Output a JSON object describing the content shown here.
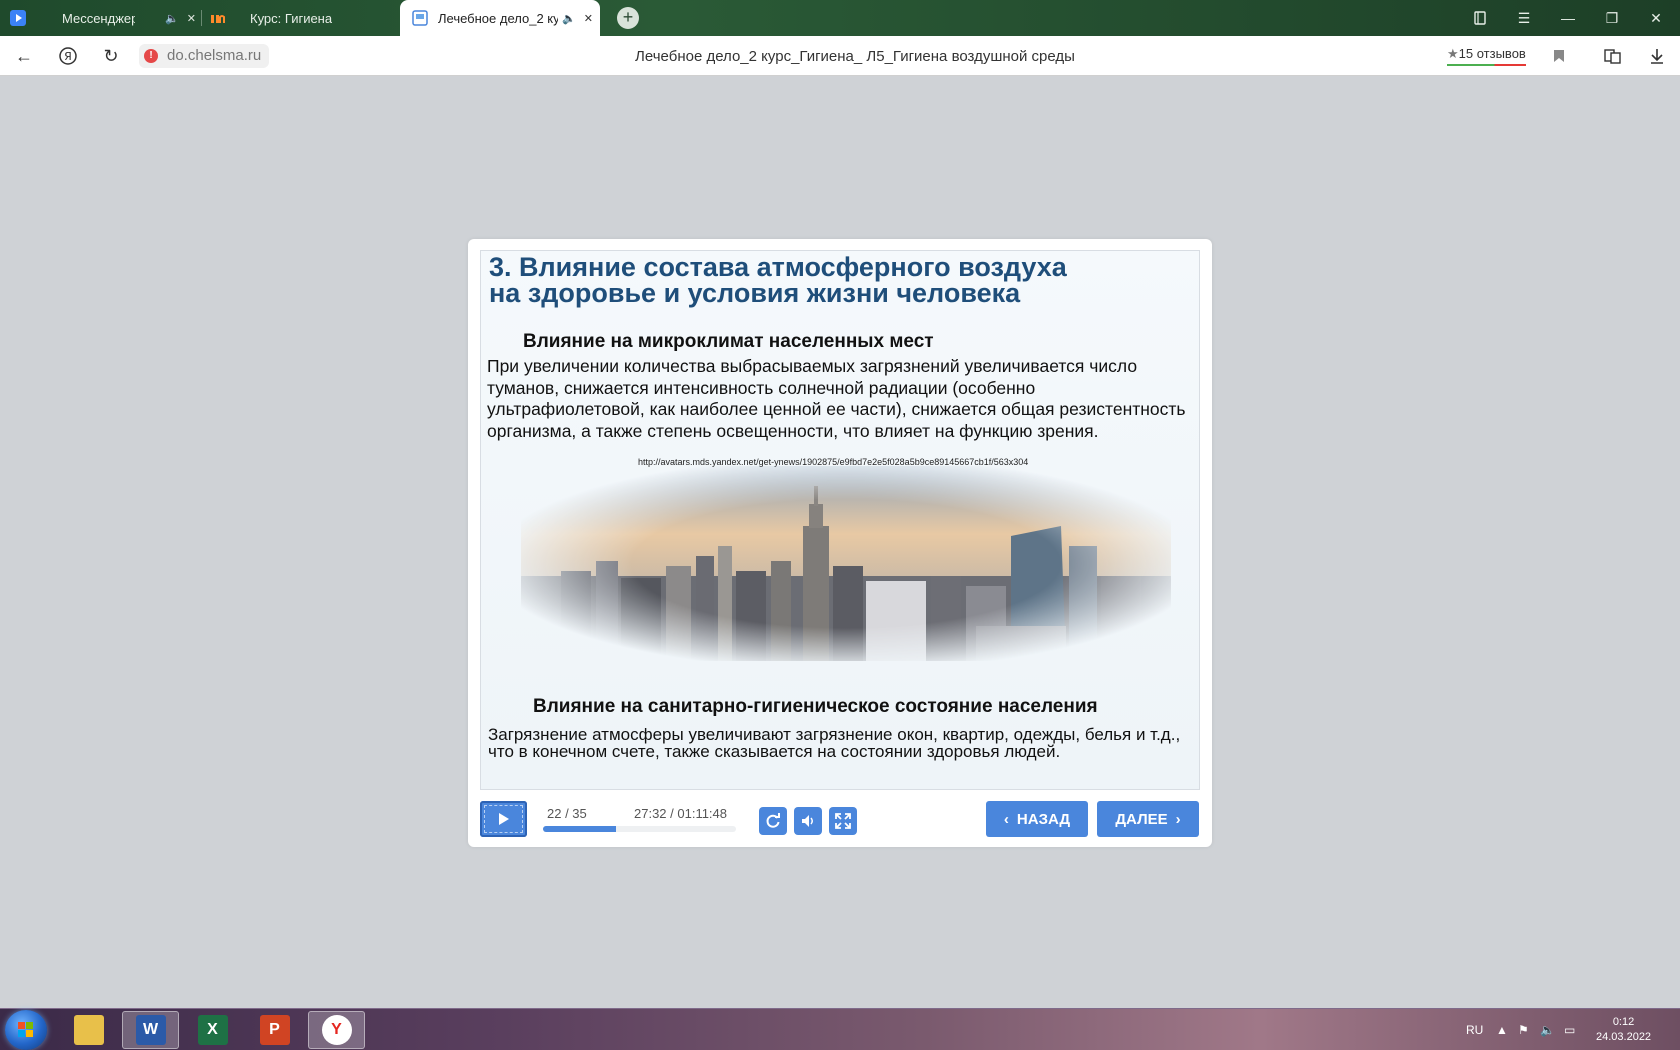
{
  "browser": {
    "tabs": [
      {
        "label": "Мессенджер",
        "icon": "messenger-icon"
      },
      {
        "label": "Курс: Гигиена",
        "icon": "course-icon"
      },
      {
        "label": "Лечебное дело_2 ку",
        "icon": "slide-icon"
      }
    ],
    "new_tab_label": "+",
    "url": "do.chelsma.ru",
    "page_title": "Лечебное дело_2 курс_Гигиена_ Л5_Гигиена воздушной среды",
    "reviews": "15 отзывов"
  },
  "slide": {
    "title_line1": "3. Влияние состава атмосферного воздуха",
    "title_line2": "на здоровье и условия жизни человека",
    "section1_heading": "Влияние на микроклимат населенных мест",
    "section1_text": "При увеличении количества выбрасываемых загрязнений увеличивается число туманов, снижается интенсивность солнечной радиации (особенно ультрафиолетовой, как наиболее ценной ее части), снижается общая резистентность организма, а также степень освещенности, что влияет на функцию зрения.",
    "image_source": "http://avatars.mds.yandex.net/get-ynews/1902875/e9fbd7e2e5f028a5b9ce89145667cb1f/563x304",
    "section2_heading": "Влияние на санитарно-гигиеническое состояние населения",
    "section2_text": "Загрязнение атмосферы увеличивают загрязнение окон, квартир, одежды, белья и т.д., что в конечном счете, также сказывается на состоянии здоровья людей."
  },
  "player": {
    "slide_counter": "22 / 35",
    "time": "27:32 / 01:11:48",
    "progress": 0.38,
    "back_label": "НАЗАД",
    "next_label": "ДАЛЕЕ"
  },
  "taskbar": {
    "apps": [
      "explorer",
      "word",
      "excel",
      "powerpoint",
      "yandex-browser"
    ],
    "language": "RU",
    "clock_time": "0:12",
    "clock_date": "24.03.2022"
  },
  "colors": {
    "accent": "#4a86dc",
    "slide_title": "#1f4e7a",
    "tabbar": "#2a5a36"
  }
}
